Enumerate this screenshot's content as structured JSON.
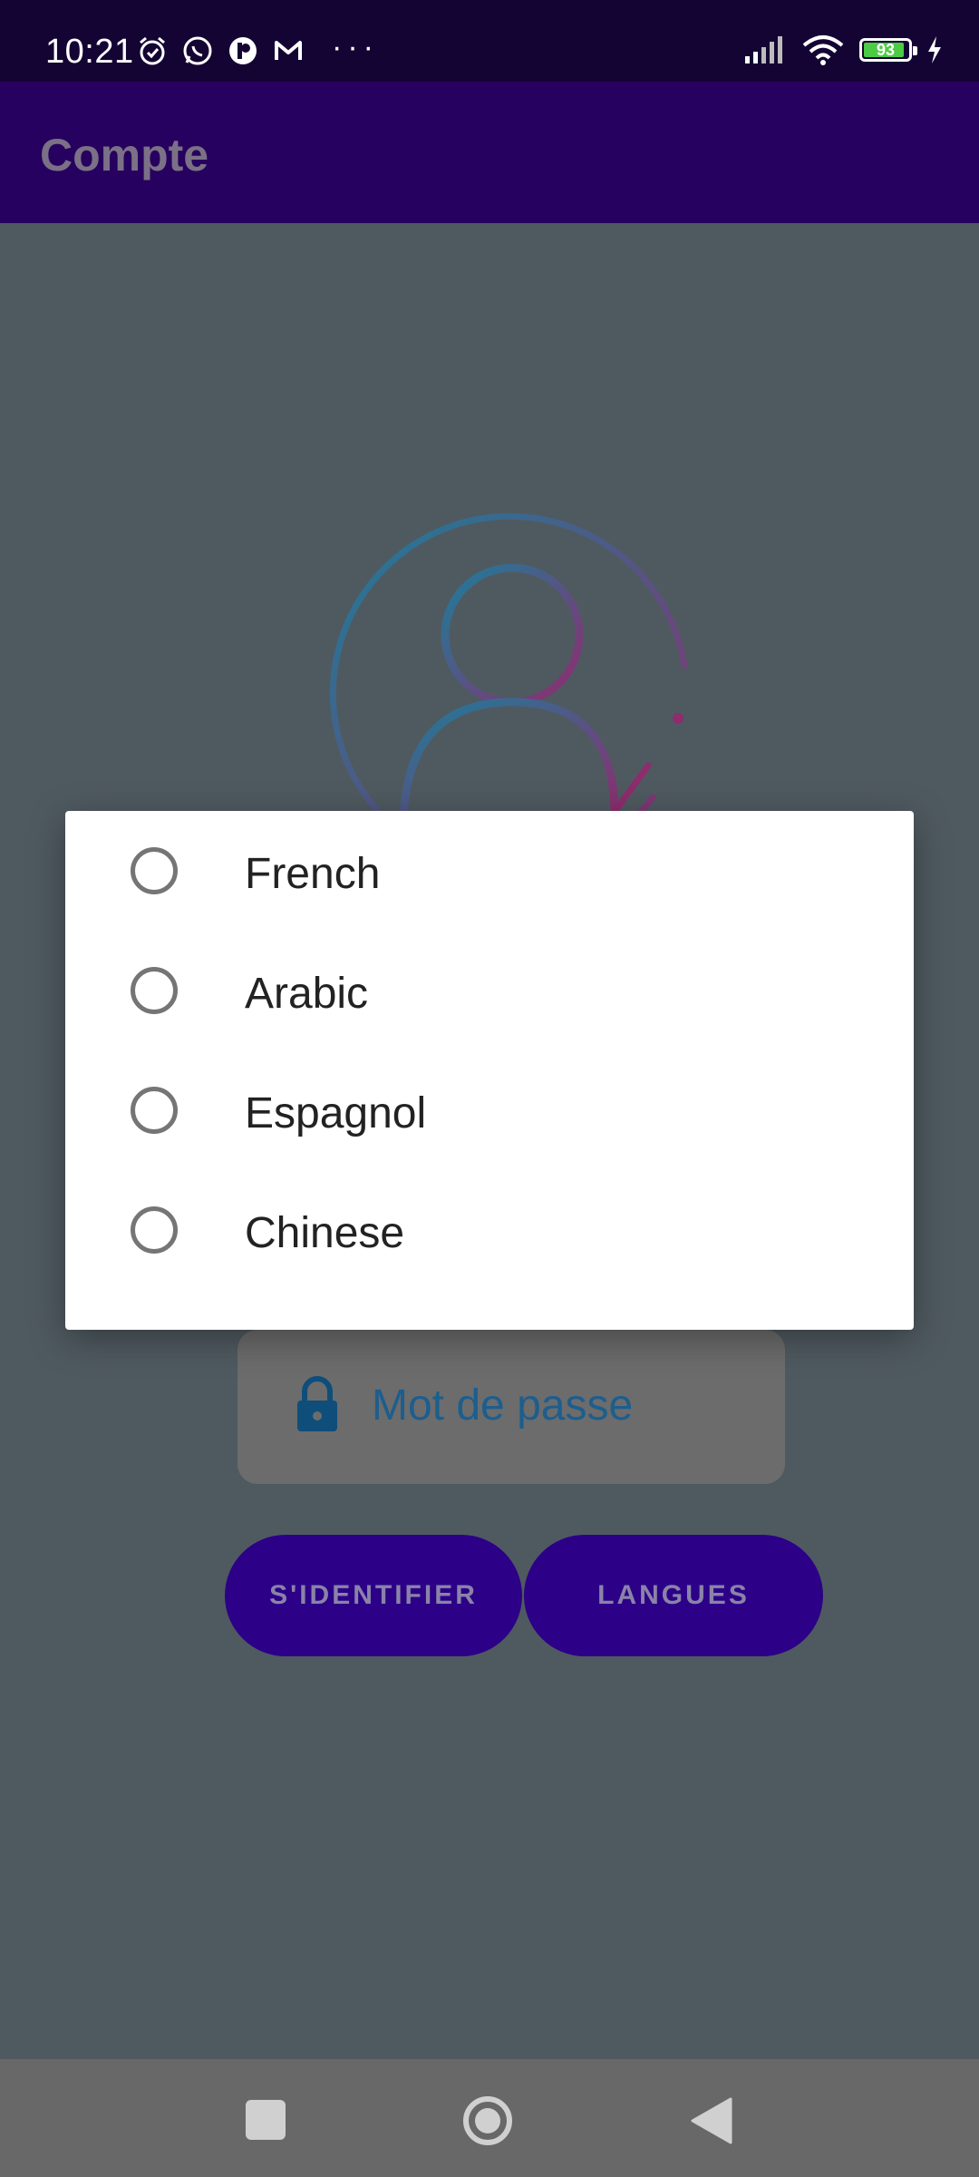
{
  "status_bar": {
    "time": "10:21",
    "battery_level": "93",
    "icons": [
      "alarm-icon",
      "whatsapp-icon",
      "app-icon",
      "gmail-icon",
      "more-dots-icon",
      "signal-icon",
      "wifi-icon",
      "battery-icon",
      "charging-icon"
    ]
  },
  "app_bar": {
    "title": "Compte"
  },
  "login": {
    "password_placeholder": "Mot de passe",
    "login_button": "S'IDENTIFIER",
    "languages_button": "LANGUES"
  },
  "language_dialog": {
    "options": [
      {
        "label": "French",
        "selected": false
      },
      {
        "label": "Arabic",
        "selected": false
      },
      {
        "label": "Espagnol",
        "selected": false
      },
      {
        "label": "Chinese",
        "selected": false
      }
    ]
  },
  "colors": {
    "status_bar": "#140433",
    "app_bar": "#27015F",
    "scrim_background": "#4F5A60",
    "button": "#2C0187",
    "radio_border": "#757575",
    "dialog": "#FFFFFF"
  }
}
